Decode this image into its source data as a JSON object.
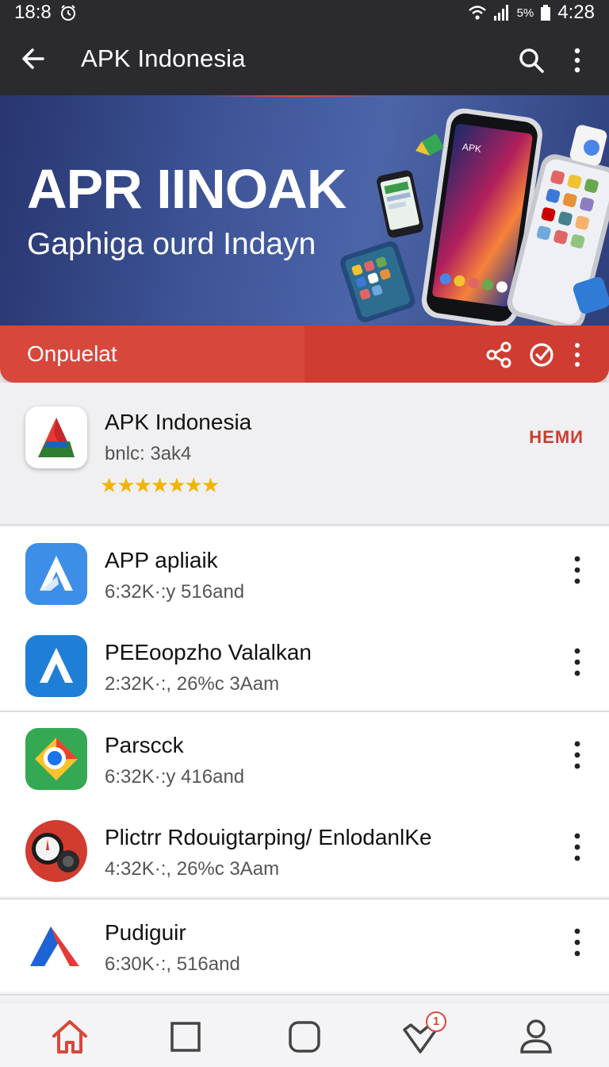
{
  "status_bar": {
    "left_time": "18:8",
    "battery_text": "5%",
    "clock": "4:28"
  },
  "app_bar": {
    "title": "APK Indonesia"
  },
  "banner": {
    "headline": "APR IINOAK",
    "subline": "Gaphiga ourd Indayn",
    "phone_label": "APK"
  },
  "action_strip": {
    "label": "Onpuelat",
    "icons": [
      "share-icon",
      "refresh-icon",
      "more-icon"
    ],
    "color": "#d8473b"
  },
  "featured": {
    "name": "APK Indonesia",
    "subtitle": "bnlc: 3ak4",
    "stars": "★★★★★★★",
    "action_label": "HEMИ"
  },
  "apps": [
    {
      "name": "APP apliaik",
      "meta": "6:32K·:y 516and",
      "icon": "blue-a-logo-icon"
    },
    {
      "name": "PEEoopzho Valalkan",
      "meta": "2:32K·:, 26%c 3Aam",
      "icon": "blue-a-logo-icon"
    },
    {
      "name": "Parscck",
      "meta": "6:32K·:y 416and",
      "icon": "chrome-like-icon"
    },
    {
      "name": "Plictrr Rdouigtarping/ EnlodanlKe",
      "meta": "4:32K·:, 26%c 3Aam",
      "icon": "gauge-icon"
    },
    {
      "name": "Pudiguir",
      "meta": "6:30K·:, 516and",
      "icon": "red-blue-a-logo-icon"
    }
  ],
  "bottom_nav": {
    "items": [
      "home-icon",
      "square-icon",
      "rounded-square-icon",
      "heart-icon",
      "profile-icon"
    ],
    "badge_count": "1",
    "accent": "#d8473b"
  }
}
